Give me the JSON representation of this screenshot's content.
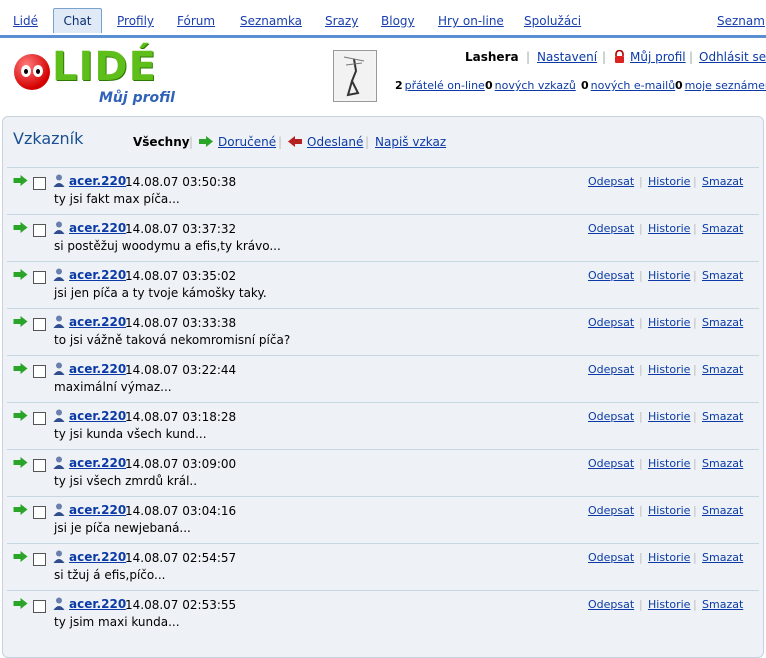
{
  "nav": {
    "items": [
      "Lidé",
      "Chat",
      "Profily",
      "Fórum",
      "Seznamka",
      "Srazy",
      "Blogy",
      "Hry on-line",
      "Spolužáci",
      "Seznam"
    ]
  },
  "logo": {
    "text": "LIDÉ",
    "subtitle": "Můj profil"
  },
  "user": {
    "name": "Lashera",
    "settings": "Nastavení",
    "my_profile": "Můj profil",
    "logout": "Odhlásit se"
  },
  "stats": {
    "friends_count": "2",
    "friends_label": "přátelé on-line",
    "messages_count": "0",
    "messages_label": "nových vzkazů",
    "emails_count": "0",
    "emails_label": "nových e-mailů",
    "dating_count": "0",
    "dating_label": "moje seznámení"
  },
  "panel": {
    "title": "Vzkazník",
    "filters": {
      "all": "Všechny",
      "received": "Doručené",
      "sent": "Odeslané",
      "write": "Napiš vzkaz"
    }
  },
  "actions": {
    "reply": "Odepsat",
    "history": "Historie",
    "delete": "Smazat"
  },
  "messages": [
    {
      "nick": "acer.220",
      "date": "14.08.07 03:50:38",
      "text": "ty jsi fakt max píča..."
    },
    {
      "nick": "acer.220",
      "date": "14.08.07 03:37:32",
      "text": "si postěžuj woodymu a efis,ty krávo..."
    },
    {
      "nick": "acer.220",
      "date": "14.08.07 03:35:02",
      "text": "jsi jen píča a ty tvoje kámošky taky."
    },
    {
      "nick": "acer.220",
      "date": "14.08.07 03:33:38",
      "text": "to jsi vážně taková nekomromisní píča?"
    },
    {
      "nick": "acer.220",
      "date": "14.08.07 03:22:44",
      "text": "maximální výmaz..."
    },
    {
      "nick": "acer.220",
      "date": "14.08.07 03:18:28",
      "text": "ty jsi kunda všech kund..."
    },
    {
      "nick": "acer.220",
      "date": "14.08.07 03:09:00",
      "text": "ty jsi všech zmrdů král.."
    },
    {
      "nick": "acer.220",
      "date": "14.08.07 03:04:16",
      "text": "jsi je píča newjebaná..."
    },
    {
      "nick": "acer.220",
      "date": "14.08.07 02:54:57",
      "text": "si tžuj á efis,píčo..."
    },
    {
      "nick": "acer.220",
      "date": "14.08.07 02:53:55",
      "text": "ty jsim maxi kunda..."
    }
  ],
  "colors": {
    "nav_line": "#5b8fd3",
    "link": "#0b3aa6",
    "logo_green": "#5fbf1a",
    "logo_red": "#d40000",
    "panel_bg": "#eef2f6"
  },
  "icons": [
    "green-arrow-icon",
    "red-arrow-icon",
    "person-icon",
    "lock-icon"
  ]
}
